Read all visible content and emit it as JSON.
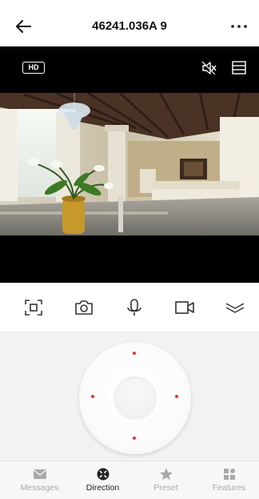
{
  "header": {
    "title": "46241.036A 9"
  },
  "viewer": {
    "quality_badge": "HD"
  },
  "controls": [
    {
      "name": "screenshot",
      "icon": "screenshot-icon"
    },
    {
      "name": "snapshot",
      "icon": "camera-icon"
    },
    {
      "name": "talk",
      "icon": "microphone-icon"
    },
    {
      "name": "record",
      "icon": "video-camera-icon"
    },
    {
      "name": "collapse",
      "icon": "double-chevron-down-icon"
    }
  ],
  "tabs": [
    {
      "label": "Messages",
      "icon": "envelope-icon",
      "active": false
    },
    {
      "label": "Direction",
      "icon": "direction-pad-icon",
      "active": true
    },
    {
      "label": "Preset",
      "icon": "star-icon",
      "active": false
    },
    {
      "label": "Features",
      "icon": "grid-icon",
      "active": false
    }
  ],
  "colors": {
    "accent_dot": "#e8352a",
    "tab_active": "#222222",
    "tab_inactive": "#a9a9a9"
  }
}
